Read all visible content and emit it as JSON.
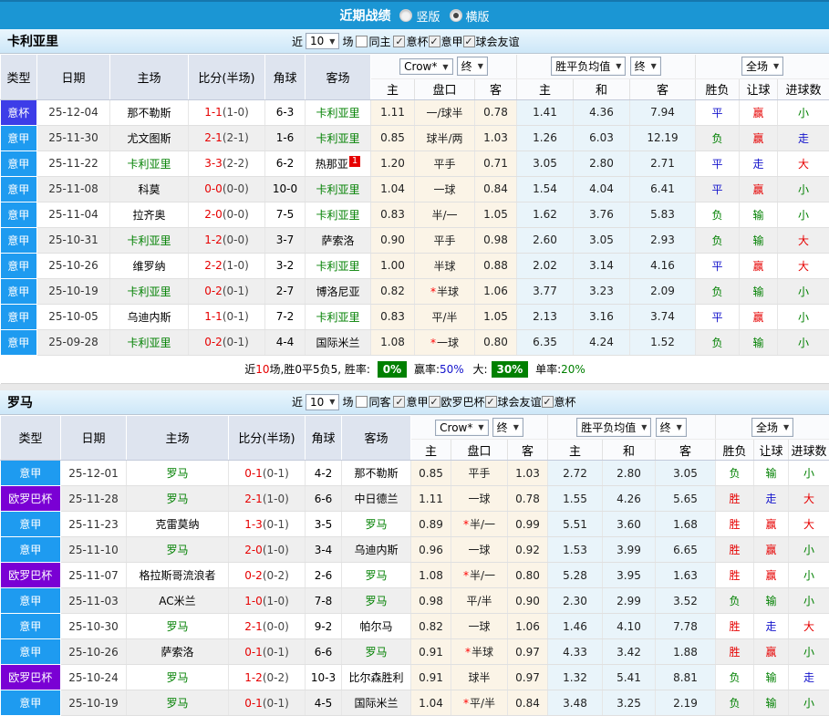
{
  "topbar": {
    "title": "近期战绩",
    "radio_vertical": "竖版",
    "radio_horizontal": "横版"
  },
  "controls_common": {
    "near": "近",
    "count": "10",
    "matches": "场"
  },
  "header_labels": {
    "type": "类型",
    "date": "日期",
    "home": "主场",
    "score": "比分(半场)",
    "corner": "角球",
    "away": "客场",
    "col_home": "主",
    "col_handicap": "盘口",
    "col_away": "客",
    "col_avg_home": "主",
    "col_avg_draw": "和",
    "col_avg_away": "客",
    "col_wl": "胜负",
    "col_ah": "让球",
    "col_goals": "进球数",
    "select_crown": "Crow*",
    "select_final": "终",
    "select_avg": "胜平负均值",
    "select_final2": "终",
    "select_fulltime": "全场"
  },
  "colors": {
    "topbar": "#1b96d4",
    "league": {
      "意甲": "#1e9bf0",
      "意杯": "#3d3de8",
      "欧罗巴杯": "#7a00d4"
    },
    "result": {
      "red": "#e60000",
      "blue": "#1414cc",
      "green": "#008000"
    }
  },
  "tables": [
    {
      "team": "卡利亚里",
      "controls": {
        "unchecked": "同主",
        "checked": [
          "意杯",
          "意甲",
          "球会友谊"
        ]
      },
      "rows": [
        {
          "league": "意杯",
          "date": "25-12-04",
          "home": "那不勒斯",
          "home_green": false,
          "score": "1-1",
          "half": "(1-0)",
          "corner": "6-3",
          "away": "卡利亚里",
          "away_green": true,
          "badge": "",
          "o1": "1.11",
          "hcap": "一/球半",
          "o2": "0.78",
          "a1": "1.41",
          "a2": "4.36",
          "a3": "7.94",
          "res": [
            {
              "t": "平",
              "c": "blue"
            },
            {
              "t": "赢",
              "c": "red"
            },
            {
              "t": "小",
              "c": "green"
            }
          ]
        },
        {
          "league": "意甲",
          "date": "25-11-30",
          "home": "尤文图斯",
          "home_green": false,
          "score": "2-1",
          "half": "(2-1)",
          "corner": "1-6",
          "away": "卡利亚里",
          "away_green": true,
          "badge": "",
          "o1": "0.85",
          "hcap": "球半/两",
          "o2": "1.03",
          "a1": "1.26",
          "a2": "6.03",
          "a3": "12.19",
          "res": [
            {
              "t": "负",
              "c": "green"
            },
            {
              "t": "赢",
              "c": "red"
            },
            {
              "t": "走",
              "c": "blue"
            }
          ]
        },
        {
          "league": "意甲",
          "date": "25-11-22",
          "home": "卡利亚里",
          "home_green": true,
          "score": "3-3",
          "half": "(2-2)",
          "corner": "6-2",
          "away": "热那亚",
          "away_green": false,
          "badge": "1",
          "o1": "1.20",
          "hcap": "平手",
          "o2": "0.71",
          "a1": "3.05",
          "a2": "2.80",
          "a3": "2.71",
          "res": [
            {
              "t": "平",
              "c": "blue"
            },
            {
              "t": "走",
              "c": "blue"
            },
            {
              "t": "大",
              "c": "red"
            }
          ]
        },
        {
          "league": "意甲",
          "date": "25-11-08",
          "home": "科莫",
          "home_green": false,
          "score": "0-0",
          "half": "(0-0)",
          "corner": "10-0",
          "away": "卡利亚里",
          "away_green": true,
          "badge": "",
          "o1": "1.04",
          "hcap": "一球",
          "o2": "0.84",
          "a1": "1.54",
          "a2": "4.04",
          "a3": "6.41",
          "res": [
            {
              "t": "平",
              "c": "blue"
            },
            {
              "t": "赢",
              "c": "red"
            },
            {
              "t": "小",
              "c": "green"
            }
          ]
        },
        {
          "league": "意甲",
          "date": "25-11-04",
          "home": "拉齐奥",
          "home_green": false,
          "score": "2-0",
          "half": "(0-0)",
          "corner": "7-5",
          "away": "卡利亚里",
          "away_green": true,
          "badge": "",
          "o1": "0.83",
          "hcap": "半/一",
          "o2": "1.05",
          "a1": "1.62",
          "a2": "3.76",
          "a3": "5.83",
          "res": [
            {
              "t": "负",
              "c": "green"
            },
            {
              "t": "输",
              "c": "green"
            },
            {
              "t": "小",
              "c": "green"
            }
          ]
        },
        {
          "league": "意甲",
          "date": "25-10-31",
          "home": "卡利亚里",
          "home_green": true,
          "score": "1-2",
          "half": "(0-0)",
          "corner": "3-7",
          "away": "萨索洛",
          "away_green": false,
          "badge": "",
          "o1": "0.90",
          "hcap": "平手",
          "o2": "0.98",
          "a1": "2.60",
          "a2": "3.05",
          "a3": "2.93",
          "res": [
            {
              "t": "负",
              "c": "green"
            },
            {
              "t": "输",
              "c": "green"
            },
            {
              "t": "大",
              "c": "red"
            }
          ]
        },
        {
          "league": "意甲",
          "date": "25-10-26",
          "home": "维罗纳",
          "home_green": false,
          "score": "2-2",
          "half": "(1-0)",
          "corner": "3-2",
          "away": "卡利亚里",
          "away_green": true,
          "badge": "",
          "o1": "1.00",
          "hcap": "半球",
          "o2": "0.88",
          "a1": "2.02",
          "a2": "3.14",
          "a3": "4.16",
          "res": [
            {
              "t": "平",
              "c": "blue"
            },
            {
              "t": "赢",
              "c": "red"
            },
            {
              "t": "大",
              "c": "red"
            }
          ]
        },
        {
          "league": "意甲",
          "date": "25-10-19",
          "home": "卡利亚里",
          "home_green": true,
          "score": "0-2",
          "half": "(0-1)",
          "corner": "2-7",
          "away": "博洛尼亚",
          "away_green": false,
          "badge": "",
          "o1": "0.82",
          "hcap": "*半球",
          "o2": "1.06",
          "a1": "3.77",
          "a2": "3.23",
          "a3": "2.09",
          "res": [
            {
              "t": "负",
              "c": "green"
            },
            {
              "t": "输",
              "c": "green"
            },
            {
              "t": "小",
              "c": "green"
            }
          ]
        },
        {
          "league": "意甲",
          "date": "25-10-05",
          "home": "乌迪内斯",
          "home_green": false,
          "score": "1-1",
          "half": "(0-1)",
          "corner": "7-2",
          "away": "卡利亚里",
          "away_green": true,
          "badge": "",
          "o1": "0.83",
          "hcap": "平/半",
          "o2": "1.05",
          "a1": "2.13",
          "a2": "3.16",
          "a3": "3.74",
          "res": [
            {
              "t": "平",
              "c": "blue"
            },
            {
              "t": "赢",
              "c": "red"
            },
            {
              "t": "小",
              "c": "green"
            }
          ]
        },
        {
          "league": "意甲",
          "date": "25-09-28",
          "home": "卡利亚里",
          "home_green": true,
          "score": "0-2",
          "half": "(0-1)",
          "corner": "4-4",
          "away": "国际米兰",
          "away_green": false,
          "badge": "",
          "o1": "1.08",
          "hcap": "*一球",
          "o2": "0.80",
          "a1": "6.35",
          "a2": "4.24",
          "a3": "1.52",
          "res": [
            {
              "t": "负",
              "c": "green"
            },
            {
              "t": "输",
              "c": "green"
            },
            {
              "t": "小",
              "c": "green"
            }
          ]
        }
      ],
      "summary": {
        "near": "近",
        "count": "10",
        "text": "场,胜0平5负5, 胜率:",
        "rate_badge": "0%",
        "win_label": "赢率:",
        "win_value": "50%",
        "big_label": "大:",
        "big_badge": "30%",
        "single_label": "单率:",
        "single_value": "20%"
      }
    },
    {
      "team": "罗马",
      "controls": {
        "unchecked": "同客",
        "checked": [
          "意甲",
          "欧罗巴杯",
          "球会友谊",
          "意杯"
        ]
      },
      "rows": [
        {
          "league": "意甲",
          "date": "25-12-01",
          "home": "罗马",
          "home_green": true,
          "score": "0-1",
          "half": "(0-1)",
          "corner": "4-2",
          "away": "那不勒斯",
          "away_green": false,
          "badge": "",
          "o1": "0.85",
          "hcap": "平手",
          "o2": "1.03",
          "a1": "2.72",
          "a2": "2.80",
          "a3": "3.05",
          "res": [
            {
              "t": "负",
              "c": "green"
            },
            {
              "t": "输",
              "c": "green"
            },
            {
              "t": "小",
              "c": "green"
            }
          ]
        },
        {
          "league": "欧罗巴杯",
          "date": "25-11-28",
          "home": "罗马",
          "home_green": true,
          "score": "2-1",
          "half": "(1-0)",
          "corner": "6-6",
          "away": "中日德兰",
          "away_green": false,
          "badge": "",
          "o1": "1.11",
          "hcap": "一球",
          "o2": "0.78",
          "a1": "1.55",
          "a2": "4.26",
          "a3": "5.65",
          "res": [
            {
              "t": "胜",
              "c": "red"
            },
            {
              "t": "走",
              "c": "blue"
            },
            {
              "t": "大",
              "c": "red"
            }
          ]
        },
        {
          "league": "意甲",
          "date": "25-11-23",
          "home": "克雷莫纳",
          "home_green": false,
          "score": "1-3",
          "half": "(0-1)",
          "corner": "3-5",
          "away": "罗马",
          "away_green": true,
          "badge": "",
          "o1": "0.89",
          "hcap": "*半/一",
          "o2": "0.99",
          "a1": "5.51",
          "a2": "3.60",
          "a3": "1.68",
          "res": [
            {
              "t": "胜",
              "c": "red"
            },
            {
              "t": "赢",
              "c": "red"
            },
            {
              "t": "大",
              "c": "red"
            }
          ]
        },
        {
          "league": "意甲",
          "date": "25-11-10",
          "home": "罗马",
          "home_green": true,
          "score": "2-0",
          "half": "(1-0)",
          "corner": "3-4",
          "away": "乌迪内斯",
          "away_green": false,
          "badge": "",
          "o1": "0.96",
          "hcap": "一球",
          "o2": "0.92",
          "a1": "1.53",
          "a2": "3.99",
          "a3": "6.65",
          "res": [
            {
              "t": "胜",
              "c": "red"
            },
            {
              "t": "赢",
              "c": "red"
            },
            {
              "t": "小",
              "c": "green"
            }
          ]
        },
        {
          "league": "欧罗巴杯",
          "date": "25-11-07",
          "home": "格拉斯哥流浪者",
          "home_green": false,
          "score": "0-2",
          "half": "(0-2)",
          "corner": "2-6",
          "away": "罗马",
          "away_green": true,
          "badge": "",
          "o1": "1.08",
          "hcap": "*半/一",
          "o2": "0.80",
          "a1": "5.28",
          "a2": "3.95",
          "a3": "1.63",
          "res": [
            {
              "t": "胜",
              "c": "red"
            },
            {
              "t": "赢",
              "c": "red"
            },
            {
              "t": "小",
              "c": "green"
            }
          ]
        },
        {
          "league": "意甲",
          "date": "25-11-03",
          "home": "AC米兰",
          "home_green": false,
          "score": "1-0",
          "half": "(1-0)",
          "corner": "7-8",
          "away": "罗马",
          "away_green": true,
          "badge": "",
          "o1": "0.98",
          "hcap": "平/半",
          "o2": "0.90",
          "a1": "2.30",
          "a2": "2.99",
          "a3": "3.52",
          "res": [
            {
              "t": "负",
              "c": "green"
            },
            {
              "t": "输",
              "c": "green"
            },
            {
              "t": "小",
              "c": "green"
            }
          ]
        },
        {
          "league": "意甲",
          "date": "25-10-30",
          "home": "罗马",
          "home_green": true,
          "score": "2-1",
          "half": "(0-0)",
          "corner": "9-2",
          "away": "帕尔马",
          "away_green": false,
          "badge": "",
          "o1": "0.82",
          "hcap": "一球",
          "o2": "1.06",
          "a1": "1.46",
          "a2": "4.10",
          "a3": "7.78",
          "res": [
            {
              "t": "胜",
              "c": "red"
            },
            {
              "t": "走",
              "c": "blue"
            },
            {
              "t": "大",
              "c": "red"
            }
          ]
        },
        {
          "league": "意甲",
          "date": "25-10-26",
          "home": "萨索洛",
          "home_green": false,
          "score": "0-1",
          "half": "(0-1)",
          "corner": "6-6",
          "away": "罗马",
          "away_green": true,
          "badge": "",
          "o1": "0.91",
          "hcap": "*半球",
          "o2": "0.97",
          "a1": "4.33",
          "a2": "3.42",
          "a3": "1.88",
          "res": [
            {
              "t": "胜",
              "c": "red"
            },
            {
              "t": "赢",
              "c": "red"
            },
            {
              "t": "小",
              "c": "green"
            }
          ]
        },
        {
          "league": "欧罗巴杯",
          "date": "25-10-24",
          "home": "罗马",
          "home_green": true,
          "score": "1-2",
          "half": "(0-2)",
          "corner": "10-3",
          "away": "比尔森胜利",
          "away_green": false,
          "badge": "",
          "o1": "0.91",
          "hcap": "球半",
          "o2": "0.97",
          "a1": "1.32",
          "a2": "5.41",
          "a3": "8.81",
          "res": [
            {
              "t": "负",
              "c": "green"
            },
            {
              "t": "输",
              "c": "green"
            },
            {
              "t": "走",
              "c": "blue"
            }
          ]
        },
        {
          "league": "意甲",
          "date": "25-10-19",
          "home": "罗马",
          "home_green": true,
          "score": "0-1",
          "half": "(0-1)",
          "corner": "4-5",
          "away": "国际米兰",
          "away_green": false,
          "badge": "",
          "o1": "1.04",
          "hcap": "*平/半",
          "o2": "0.84",
          "a1": "3.48",
          "a2": "3.25",
          "a3": "2.19",
          "res": [
            {
              "t": "负",
              "c": "green"
            },
            {
              "t": "输",
              "c": "green"
            },
            {
              "t": "小",
              "c": "green"
            }
          ]
        }
      ]
    }
  ]
}
